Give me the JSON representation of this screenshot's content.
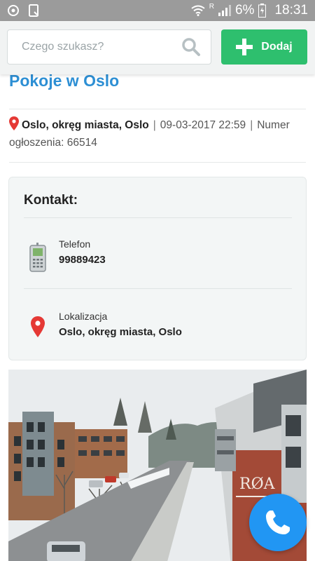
{
  "status_bar": {
    "battery": "6%",
    "time": "18:31",
    "signal_label": "R"
  },
  "header": {
    "search": {
      "placeholder": "Czego szukasz?",
      "value": ""
    },
    "add_button": {
      "label": "Dodaj"
    }
  },
  "listing": {
    "title": "Pokoje w Oslo",
    "location": "Oslo, okręg miasta, Oslo",
    "date": "09-03-2017 22:59",
    "number_text": "Numer ogłoszenia: 66514"
  },
  "contact": {
    "heading": "Kontakt:",
    "phone": {
      "label": "Telefon",
      "value": "99889423"
    },
    "location": {
      "label": "Lokalizacja",
      "value": "Oslo, okręg miasta, Oslo"
    }
  },
  "colors": {
    "accent": "#2d8fd4",
    "add_button": "#2ebf6e",
    "call_button": "#2196f3",
    "pin": "#e53935"
  },
  "icons": {
    "search": "search-icon",
    "add": "plus-icon",
    "phone": "mobile-phone-icon",
    "location": "map-pin-icon",
    "call": "phone-call-icon"
  }
}
